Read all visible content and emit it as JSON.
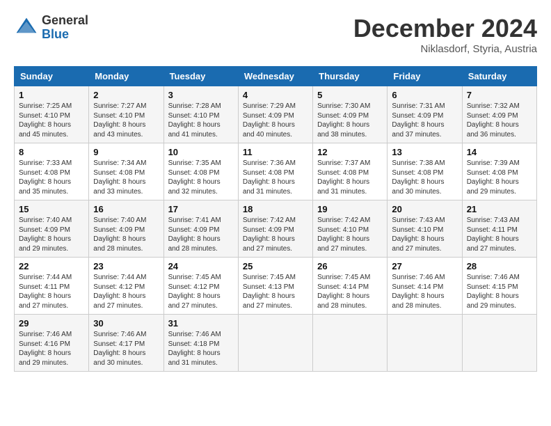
{
  "header": {
    "logo_general": "General",
    "logo_blue": "Blue",
    "title": "December 2024",
    "location": "Niklasdorf, Styria, Austria"
  },
  "days_of_week": [
    "Sunday",
    "Monday",
    "Tuesday",
    "Wednesday",
    "Thursday",
    "Friday",
    "Saturday"
  ],
  "weeks": [
    [
      {
        "day": "1",
        "text": "Sunrise: 7:25 AM\nSunset: 4:10 PM\nDaylight: 8 hours and 45 minutes."
      },
      {
        "day": "2",
        "text": "Sunrise: 7:27 AM\nSunset: 4:10 PM\nDaylight: 8 hours and 43 minutes."
      },
      {
        "day": "3",
        "text": "Sunrise: 7:28 AM\nSunset: 4:10 PM\nDaylight: 8 hours and 41 minutes."
      },
      {
        "day": "4",
        "text": "Sunrise: 7:29 AM\nSunset: 4:09 PM\nDaylight: 8 hours and 40 minutes."
      },
      {
        "day": "5",
        "text": "Sunrise: 7:30 AM\nSunset: 4:09 PM\nDaylight: 8 hours and 38 minutes."
      },
      {
        "day": "6",
        "text": "Sunrise: 7:31 AM\nSunset: 4:09 PM\nDaylight: 8 hours and 37 minutes."
      },
      {
        "day": "7",
        "text": "Sunrise: 7:32 AM\nSunset: 4:09 PM\nDaylight: 8 hours and 36 minutes."
      }
    ],
    [
      {
        "day": "8",
        "text": "Sunrise: 7:33 AM\nSunset: 4:08 PM\nDaylight: 8 hours and 35 minutes."
      },
      {
        "day": "9",
        "text": "Sunrise: 7:34 AM\nSunset: 4:08 PM\nDaylight: 8 hours and 33 minutes."
      },
      {
        "day": "10",
        "text": "Sunrise: 7:35 AM\nSunset: 4:08 PM\nDaylight: 8 hours and 32 minutes."
      },
      {
        "day": "11",
        "text": "Sunrise: 7:36 AM\nSunset: 4:08 PM\nDaylight: 8 hours and 31 minutes."
      },
      {
        "day": "12",
        "text": "Sunrise: 7:37 AM\nSunset: 4:08 PM\nDaylight: 8 hours and 31 minutes."
      },
      {
        "day": "13",
        "text": "Sunrise: 7:38 AM\nSunset: 4:08 PM\nDaylight: 8 hours and 30 minutes."
      },
      {
        "day": "14",
        "text": "Sunrise: 7:39 AM\nSunset: 4:08 PM\nDaylight: 8 hours and 29 minutes."
      }
    ],
    [
      {
        "day": "15",
        "text": "Sunrise: 7:40 AM\nSunset: 4:09 PM\nDaylight: 8 hours and 29 minutes."
      },
      {
        "day": "16",
        "text": "Sunrise: 7:40 AM\nSunset: 4:09 PM\nDaylight: 8 hours and 28 minutes."
      },
      {
        "day": "17",
        "text": "Sunrise: 7:41 AM\nSunset: 4:09 PM\nDaylight: 8 hours and 28 minutes."
      },
      {
        "day": "18",
        "text": "Sunrise: 7:42 AM\nSunset: 4:09 PM\nDaylight: 8 hours and 27 minutes."
      },
      {
        "day": "19",
        "text": "Sunrise: 7:42 AM\nSunset: 4:10 PM\nDaylight: 8 hours and 27 minutes."
      },
      {
        "day": "20",
        "text": "Sunrise: 7:43 AM\nSunset: 4:10 PM\nDaylight: 8 hours and 27 minutes."
      },
      {
        "day": "21",
        "text": "Sunrise: 7:43 AM\nSunset: 4:11 PM\nDaylight: 8 hours and 27 minutes."
      }
    ],
    [
      {
        "day": "22",
        "text": "Sunrise: 7:44 AM\nSunset: 4:11 PM\nDaylight: 8 hours and 27 minutes."
      },
      {
        "day": "23",
        "text": "Sunrise: 7:44 AM\nSunset: 4:12 PM\nDaylight: 8 hours and 27 minutes."
      },
      {
        "day": "24",
        "text": "Sunrise: 7:45 AM\nSunset: 4:12 PM\nDaylight: 8 hours and 27 minutes."
      },
      {
        "day": "25",
        "text": "Sunrise: 7:45 AM\nSunset: 4:13 PM\nDaylight: 8 hours and 27 minutes."
      },
      {
        "day": "26",
        "text": "Sunrise: 7:45 AM\nSunset: 4:14 PM\nDaylight: 8 hours and 28 minutes."
      },
      {
        "day": "27",
        "text": "Sunrise: 7:46 AM\nSunset: 4:14 PM\nDaylight: 8 hours and 28 minutes."
      },
      {
        "day": "28",
        "text": "Sunrise: 7:46 AM\nSunset: 4:15 PM\nDaylight: 8 hours and 29 minutes."
      }
    ],
    [
      {
        "day": "29",
        "text": "Sunrise: 7:46 AM\nSunset: 4:16 PM\nDaylight: 8 hours and 29 minutes."
      },
      {
        "day": "30",
        "text": "Sunrise: 7:46 AM\nSunset: 4:17 PM\nDaylight: 8 hours and 30 minutes."
      },
      {
        "day": "31",
        "text": "Sunrise: 7:46 AM\nSunset: 4:18 PM\nDaylight: 8 hours and 31 minutes."
      },
      null,
      null,
      null,
      null
    ]
  ]
}
